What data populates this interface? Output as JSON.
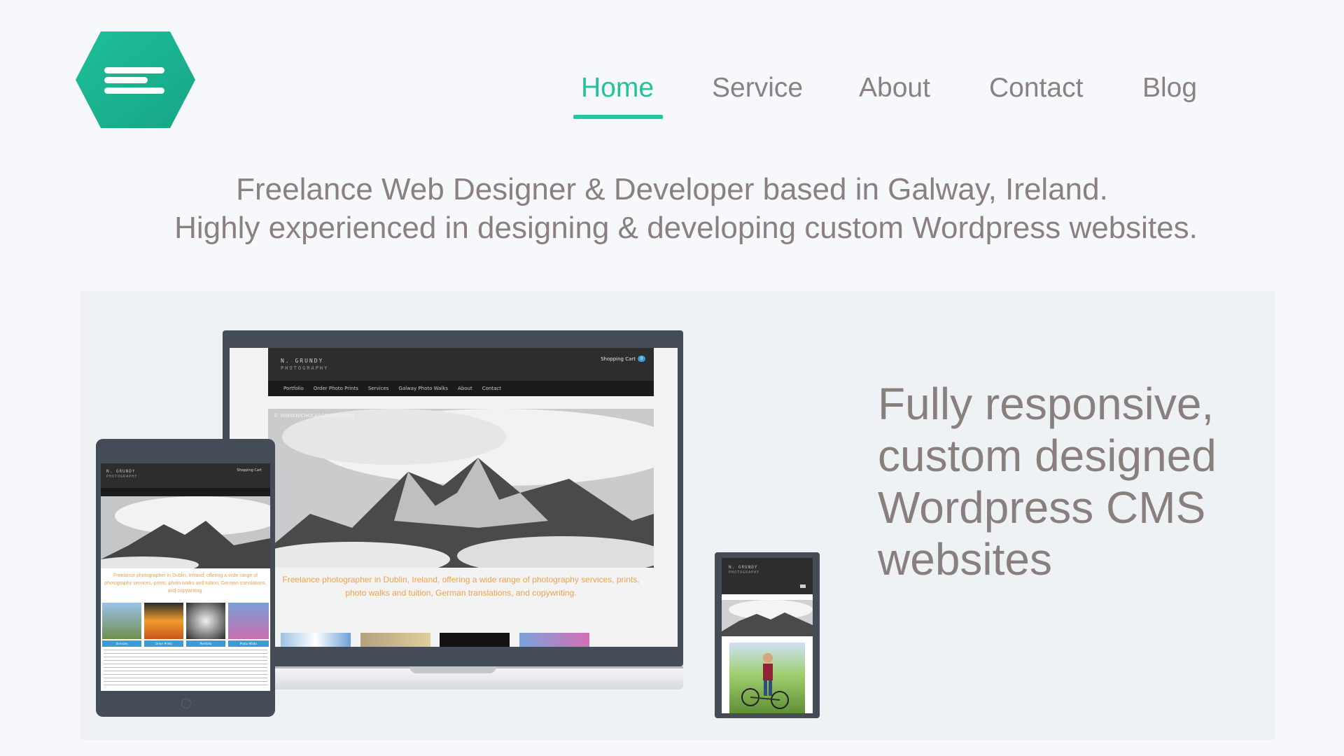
{
  "nav": {
    "items": [
      {
        "label": "Home",
        "active": true
      },
      {
        "label": "Service",
        "active": false
      },
      {
        "label": "About",
        "active": false
      },
      {
        "label": "Contact",
        "active": false
      },
      {
        "label": "Blog",
        "active": false
      }
    ]
  },
  "intro": {
    "line1": "Freelance Web Designer & Developer based in Galway, Ireland.",
    "line2": "Highly experienced in designing & developing custom Wordpress websites."
  },
  "feature": {
    "headline_lines": [
      "Fully responsive,",
      "custom designed",
      "Wordpress CMS",
      "websites"
    ]
  },
  "mockup_site": {
    "brand_line1": "N.     GRUNDY",
    "brand_line2": "PHOTOGRAPHY",
    "cart_label": "Shopping Cart",
    "cart_count": "0",
    "nav_items": [
      "Portfolio",
      "Order Photo Prints",
      "Services",
      "Galway Photo Walks",
      "About",
      "Contact"
    ],
    "watermark": "© WWW.NICHOLASGRUNDY.COM",
    "tagline": "Freelance photographer in Dublin, Ireland, offering a wide range of photography services, prints, photo walks and tuition, German translations, and copywriting.",
    "tablet_tiles": [
      "Services",
      "Order Prints",
      "Portfolio",
      "Photo Walks"
    ]
  },
  "colors": {
    "accent": "#24c29a",
    "text": "#8a7f7f",
    "device": "#444d57",
    "background": "#f6f8fb",
    "panel": "#eef2f5"
  },
  "icons": {
    "logo": "hexagon-menu-icon"
  }
}
